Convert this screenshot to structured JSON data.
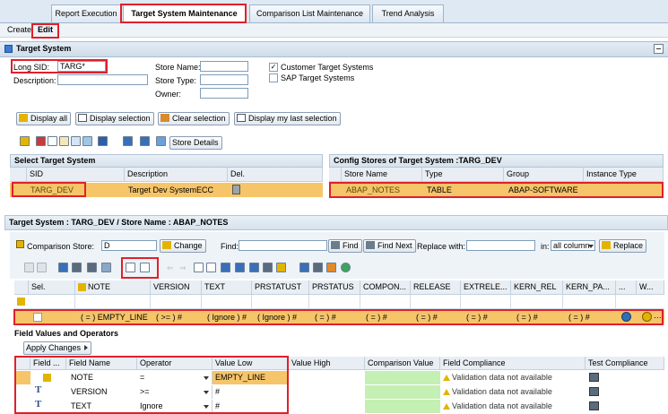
{
  "tabs": [
    "Report Execution",
    "Target System Maintenance",
    "Comparison List Maintenance",
    "Trend Analysis"
  ],
  "menu": {
    "create": "Create",
    "edit": "Edit"
  },
  "target_system_panel": {
    "title": "Target System",
    "long_sid_label": "Long SID:",
    "long_sid_value": "TARG*",
    "description_label": "Description:",
    "store_name_label": "Store Name:",
    "store_type_label": "Store Type:",
    "owner_label": "Owner:",
    "customer_target_systems_label": "Customer Target Systems",
    "customer_target_systems_checked": true,
    "sap_target_systems_label": "SAP Target Systems",
    "sap_target_systems_checked": false
  },
  "buttons": {
    "display_all": "Display all",
    "display_selection": "Display selection",
    "clear_selection": "Clear selection",
    "display_last_selection": "Display my last selection",
    "store_details": "Store Details"
  },
  "select_target_system": {
    "title": "Select Target System",
    "columns": [
      "SID",
      "Description",
      "Del."
    ],
    "rows": [
      {
        "sid": "TARG_DEV",
        "description": "Target Dev SystemECC"
      }
    ]
  },
  "config_stores": {
    "title": "Config Stores of Target System :TARG_DEV",
    "columns": [
      "Store Name",
      "Type",
      "Group",
      "Instance Type"
    ],
    "rows": [
      {
        "store_name": "ABAP_NOTES",
        "type": "TABLE",
        "group": "ABAP-SOFTWARE",
        "instance_type": ""
      }
    ]
  },
  "detail": {
    "title": "Target System : TARG_DEV / Store Name : ABAP_NOTES",
    "comparison_store_label": "Comparison Store:",
    "comparison_store_value": "D",
    "change_button": "Change",
    "find_label": "Find:",
    "find_button": "Find",
    "find_next_button": "Find Next",
    "replace_with_label": "Replace with:",
    "in_label": "in:",
    "in_value": "all column",
    "replace_button": "Replace"
  },
  "grid": {
    "columns": [
      "Sel.",
      "NOTE",
      "VERSION",
      "TEXT",
      "PRSTATUST",
      "PRSTATUS",
      "COMPON...",
      "RELEASE",
      "EXTRELE...",
      "KERN_REL",
      "KERN_PA...",
      "...",
      "W..."
    ],
    "row": [
      "",
      "( = ) EMPTY_LINE",
      "( >= ) #",
      "( Ignore ) #",
      "( Ignore ) #",
      "( = ) #",
      "( = ) #",
      "( = ) #",
      "( = ) #",
      "( = ) #",
      "( = ) #",
      "",
      ""
    ]
  },
  "field_values": {
    "title": "Field Values and Operators",
    "apply_changes": "Apply Changes",
    "columns": [
      "Field ...",
      "Field Name",
      "Operator",
      "Value Low",
      "Value High",
      "Comparison Value",
      "Field Compliance",
      "Test Compliance"
    ],
    "rows": [
      {
        "field_name": "NOTE",
        "operator": "=",
        "value_low": "EMPTY_LINE",
        "compliance": "Validation data not available"
      },
      {
        "field_name": "VERSION",
        "operator": ">=",
        "value_low": "#",
        "compliance": "Validation data not available"
      },
      {
        "field_name": "TEXT",
        "operator": "Ignore",
        "value_low": "#",
        "compliance": "Validation data not available"
      }
    ]
  },
  "colors": {
    "highlight": "#f6c56a",
    "annotation": "#e0202a",
    "green_cell": "#c4f0b4",
    "header_bg": "#dfe9f3"
  }
}
